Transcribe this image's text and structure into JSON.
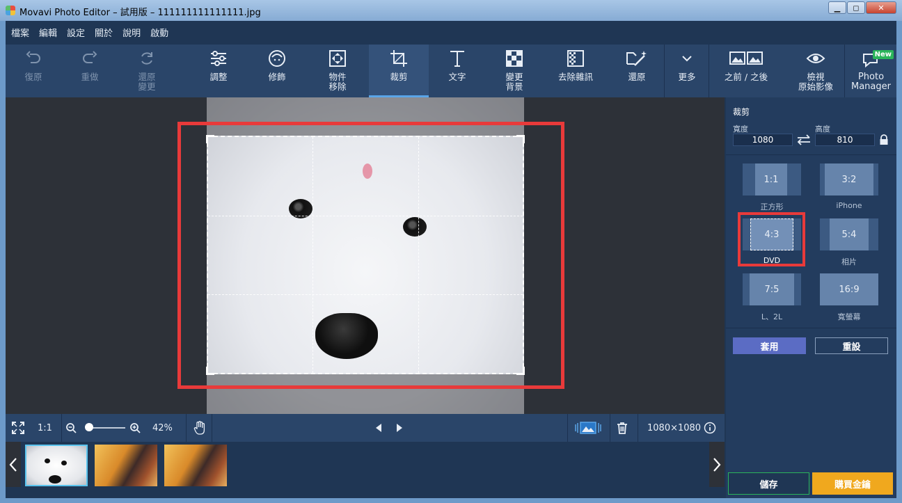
{
  "window": {
    "title": "Movavi Photo Editor – 試用版 – 111111111111111.jpg",
    "btn_min": "▁",
    "btn_max": "◻",
    "btn_close": "✕"
  },
  "menu": [
    "檔案",
    "編輯",
    "設定",
    "關於",
    "說明",
    "啟動"
  ],
  "toolbar": {
    "undo": "復原",
    "redo": "重做",
    "restore_line1": "還原",
    "restore_line2": "變更",
    "adjust": "調整",
    "retouch": "修飾",
    "object_line1": "物件",
    "object_line2": "移除",
    "crop": "裁剪",
    "text": "文字",
    "bg_line1": "變更",
    "bg_line2": "背景",
    "denoise": "去除雜訊",
    "restore_photo": "還原",
    "more": "更多",
    "before_after": "之前 / 之後",
    "view_line1": "檢視",
    "view_line2": "原始影像",
    "pm_line1": "Photo",
    "pm_line2": "Manager",
    "new_badge": "New"
  },
  "statusbar": {
    "one_to_one": "1:1",
    "zoom": "42%",
    "dimensions": "1080×1080",
    "zoom_level": 0.15
  },
  "panel": {
    "title": "裁剪",
    "width_label": "寬度",
    "width_value": "1080",
    "height_label": "高度",
    "height_value": "810",
    "ratios": [
      {
        "ratio": "1:1",
        "label": "正方形"
      },
      {
        "ratio": "3:2",
        "label": "iPhone"
      },
      {
        "ratio": "4:3",
        "label": "DVD"
      },
      {
        "ratio": "5:4",
        "label": "相片"
      },
      {
        "ratio": "7:5",
        "label": "L、2L"
      },
      {
        "ratio": "16:9",
        "label": "寬螢幕"
      }
    ],
    "apply": "套用",
    "reset": "重設",
    "save": "儲存",
    "buy": "購買金鑰"
  },
  "colors": {
    "accent": "#5aa5e8",
    "highlight": "#e83a3a",
    "buy": "#f0a81e",
    "apply": "#5b6cc4"
  }
}
